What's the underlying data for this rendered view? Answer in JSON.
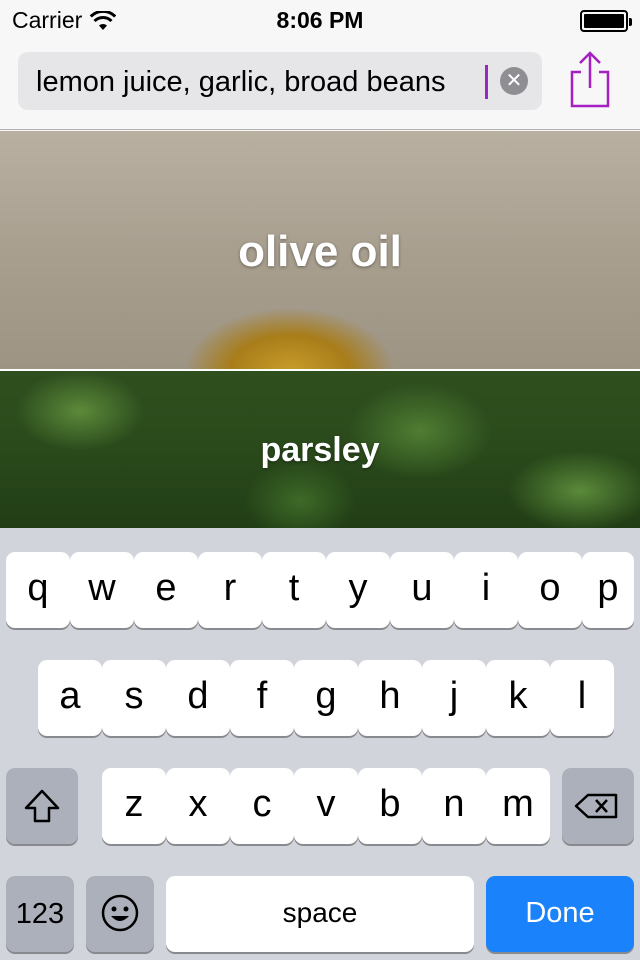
{
  "status": {
    "carrier": "Carrier",
    "time": "8:06 PM"
  },
  "search": {
    "query": "lemon juice, garlic, broad beans"
  },
  "results": [
    {
      "label": "olive oil"
    },
    {
      "label": "parsley"
    }
  ],
  "keyboard": {
    "row1": [
      "q",
      "w",
      "e",
      "r",
      "t",
      "y",
      "u",
      "i",
      "o",
      "p"
    ],
    "row2": [
      "a",
      "s",
      "d",
      "f",
      "g",
      "h",
      "j",
      "k",
      "l"
    ],
    "row3": [
      "z",
      "x",
      "c",
      "v",
      "b",
      "n",
      "m"
    ],
    "numbers_label": "123",
    "space_label": "space",
    "done_label": "Done"
  },
  "colors": {
    "accent": "#9b27c2",
    "done_key": "#1a82fb"
  },
  "icons": {
    "wifi": "wifi-icon",
    "battery": "battery-icon",
    "share": "share-icon",
    "clear": "clear-icon",
    "shift": "shift-icon",
    "delete": "delete-icon",
    "emoji": "emoji-icon"
  }
}
